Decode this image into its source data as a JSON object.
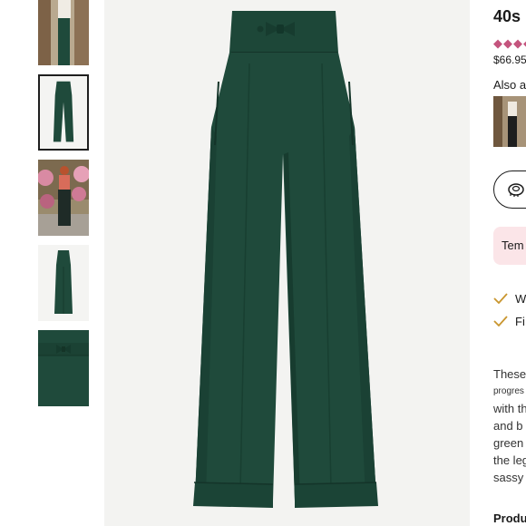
{
  "gallery": {
    "thumbnails": [
      {
        "name": "model-white-blouse"
      },
      {
        "name": "pants-front",
        "selected": true
      },
      {
        "name": "model-outdoors"
      },
      {
        "name": "pants-side"
      },
      {
        "name": "waistband-bow-detail"
      }
    ],
    "main_image": {
      "name": "green-wide-leg-pants-front"
    }
  },
  "product": {
    "title": "40s",
    "rating_stars_shown": 4,
    "price": "$66.95",
    "also_available_label": "Also a",
    "size_button_icon": "measuring-tape-icon",
    "promo_label": "Tem",
    "usps": [
      {
        "icon": "check-icon",
        "text": "W"
      },
      {
        "icon": "check-icon",
        "text": "Fi"
      }
    ],
    "description_lines": [
      "These",
      "progres",
      "with th",
      "and b",
      "green",
      "the leg",
      "sassy"
    ],
    "product_details_label": "Produ"
  },
  "colors": {
    "pants": "#1f4a3b",
    "accent_pink": "#c4547d",
    "promo_bg": "#fbe5e8",
    "check": "#c9962f"
  }
}
